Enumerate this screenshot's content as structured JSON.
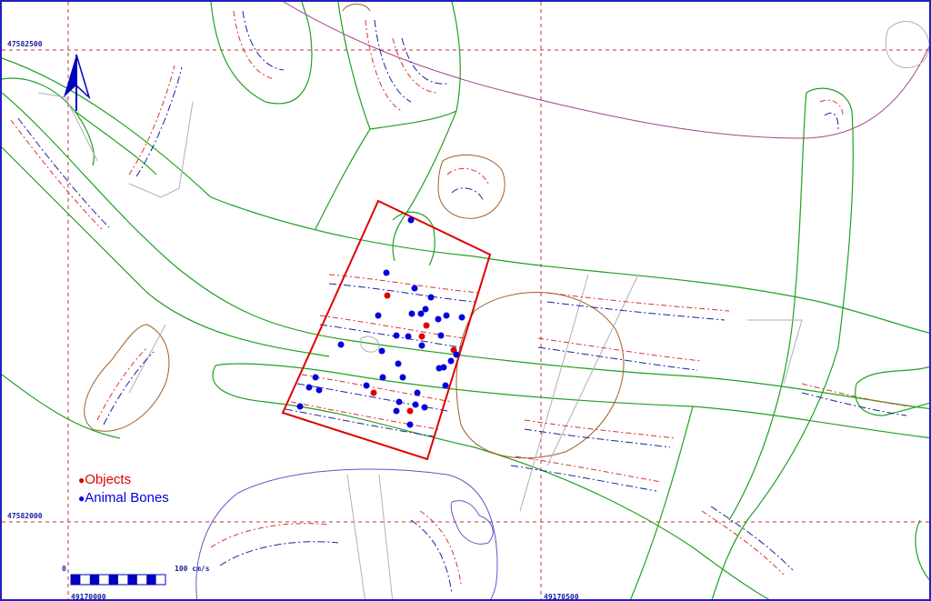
{
  "grid": {
    "northing_labels": [
      "47582500",
      "47582000"
    ],
    "easting_labels": [
      "49170000",
      "49170500"
    ]
  },
  "legend": {
    "objects": {
      "label": "Objects",
      "color": "#e00000"
    },
    "animal_bones": {
      "label": "Animal Bones",
      "color": "#0000e0"
    }
  },
  "scale_bar": {
    "start": "0",
    "end": "100 cm/s"
  },
  "colors": {
    "grid": "#c0303a",
    "contour_green": "#20a020",
    "contour_brown": "#a0602a",
    "contour_blue": "#5a5ac8",
    "excavation": "#e00000",
    "north_arrow": "#0000c0",
    "profile_red": "#e03030",
    "profile_blue": "#2020a0"
  },
  "icons": [
    "north-arrow-icon"
  ]
}
